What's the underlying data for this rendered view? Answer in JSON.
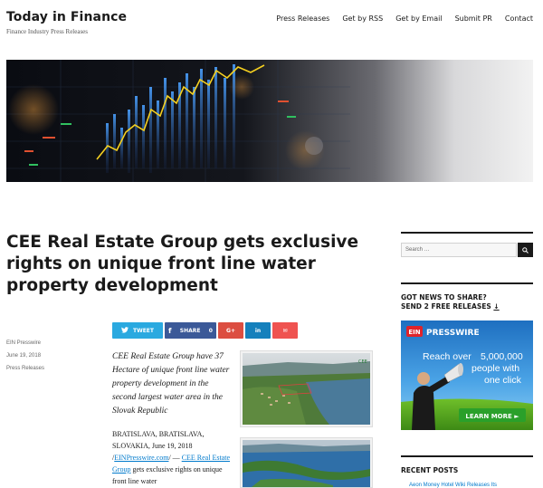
{
  "site": {
    "title": "Today in Finance",
    "description": "Finance Industry Press Releases"
  },
  "nav": [
    {
      "label": "Press Releases"
    },
    {
      "label": "Get by RSS"
    },
    {
      "label": "Get by Email"
    },
    {
      "label": "Submit PR"
    },
    {
      "label": "Contact"
    }
  ],
  "article": {
    "title": "CEE Real Estate Group gets exclusive rights on unique front line water property development",
    "meta": {
      "author": "EIN Presswire",
      "date": "June 19, 2018",
      "category": "Press Releases"
    },
    "share": {
      "tweet_label": "TWEET",
      "share_label": "SHARE",
      "share_count": "0",
      "gplus_label": "G+",
      "linkedin_label": "in",
      "email_label": "✉"
    },
    "lead": "CEE Real Estate Group have 37 Hectare of unique front line water property development in the second largest water area in the Slovak Republic",
    "dateline": "BRATISLAVA, BRATISLAVA, SLOVAKIA, June 19, 2018 /",
    "source_link": "EINPresswire.com",
    "dash": "/ — ",
    "company_link": "CEE Real Estate Group",
    "body_rest": " gets exclusive rights on unique front line water",
    "photo_badge": "CEE"
  },
  "sidebar": {
    "search_placeholder": "Search …",
    "news_heading_line1": "GOT NEWS TO SHARE?",
    "news_heading_line2": "SEND 2 FREE RELEASES",
    "news_heading_arrow": "↓",
    "ad": {
      "brand_badge": "EIN",
      "brand_name": "PRESSWIRE",
      "reach_line1": "Reach over",
      "reach_number": "5,000,000",
      "reach_line2": "people with",
      "reach_line3": "one click",
      "cta": "LEARN MORE ►"
    },
    "recent_heading": "RECENT POSTS",
    "recent_item": "Aeon Money Hotel Wiki Releases Its"
  },
  "colors": {
    "link": "#007acc",
    "twitter": "#2aa9e0",
    "facebook": "#3b5998",
    "gplus": "#dc4e41",
    "linkedin": "#1580bc",
    "email": "#ef5350"
  },
  "icons": [
    "search-icon",
    "twitter-icon",
    "facebook-icon",
    "megaphone-icon"
  ]
}
